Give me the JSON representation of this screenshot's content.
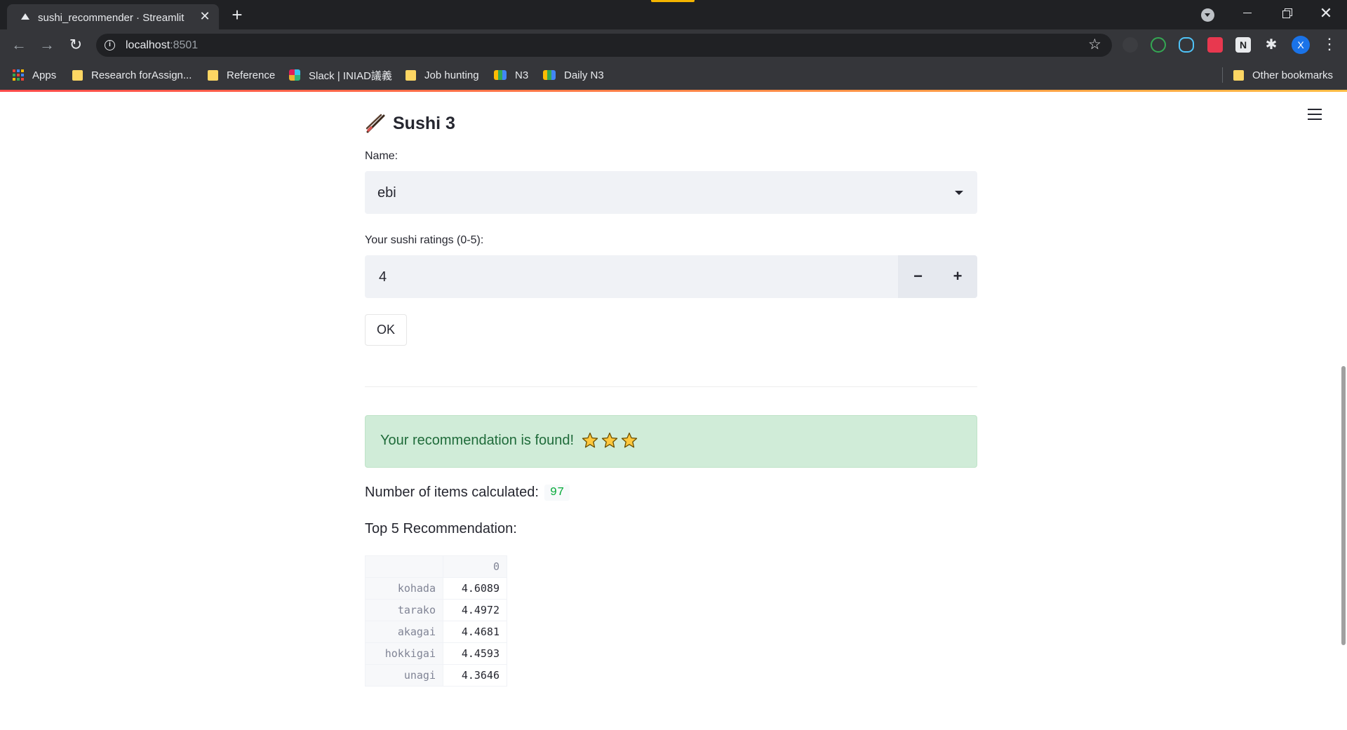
{
  "browser": {
    "tab_title": "sushi_recommender · Streamlit",
    "new_tab_label": "+",
    "close_tab_label": "✕",
    "url_host": "localhost",
    "url_port": ":8501",
    "profile_initial": "X",
    "bookmarks": [
      {
        "label": "Apps",
        "icon": "apps-grid-icon"
      },
      {
        "label": "Research forAssign...",
        "icon": "folder-icon"
      },
      {
        "label": "Reference",
        "icon": "folder-icon"
      },
      {
        "label": "Slack | INIAD議義",
        "icon": "slack-icon"
      },
      {
        "label": "Job hunting",
        "icon": "folder-icon"
      },
      {
        "label": "N3",
        "icon": "meet-icon"
      },
      {
        "label": "Daily N3",
        "icon": "meet-icon"
      }
    ],
    "other_bookmarks": "Other bookmarks"
  },
  "app": {
    "title": "Sushi 3",
    "name_label": "Name:",
    "name_value": "ebi",
    "rating_label": "Your sushi ratings (0-5):",
    "rating_value": "4",
    "minus_label": "−",
    "plus_label": "+",
    "ok_label": "OK",
    "alert_text": "Your recommendation is found!",
    "alert_star_count": 3,
    "items_label": "Number of items calculated:",
    "items_count": "97",
    "top5_label": "Top 5 Recommendation:",
    "table": {
      "column_header": "0",
      "rows": [
        {
          "name": "kohada",
          "score": "4.6089"
        },
        {
          "name": "tarako",
          "score": "4.4972"
        },
        {
          "name": "akagai",
          "score": "4.4681"
        },
        {
          "name": "hokkigai",
          "score": "4.4593"
        },
        {
          "name": "unagi",
          "score": "4.3646"
        }
      ]
    }
  },
  "colors": {
    "accent_gradient_start": "#ff4b4b",
    "accent_gradient_end": "#ffbd45",
    "success_bg": "#d0ecd8",
    "success_text": "#1f6b3a",
    "count_green": "#09ab3b"
  }
}
